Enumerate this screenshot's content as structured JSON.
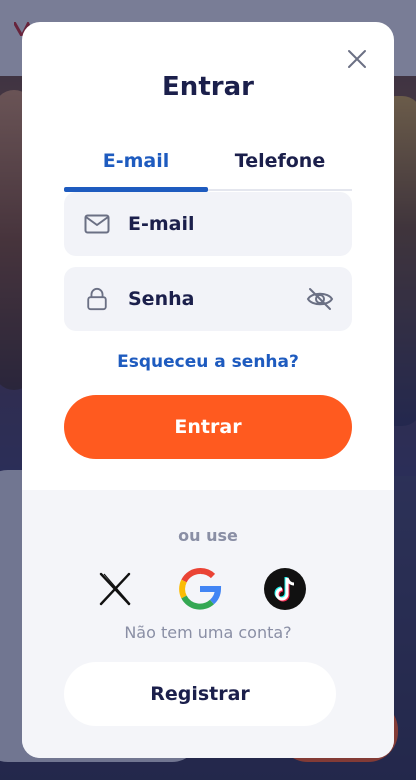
{
  "modal": {
    "title": "Entrar",
    "tabs": [
      {
        "label": "E-mail",
        "active": true
      },
      {
        "label": "Telefone",
        "active": false
      }
    ],
    "email_field": {
      "placeholder": "E-mail",
      "icon": "envelope-icon"
    },
    "password_field": {
      "placeholder": "Senha",
      "icon": "lock-icon",
      "toggle_icon": "eye-off-icon"
    },
    "forgot_label": "Esqueceu a senha?",
    "submit_label": "Entrar",
    "alt_label": "ou use",
    "social": [
      {
        "name": "X",
        "icon": "x-logo-icon"
      },
      {
        "name": "Google",
        "icon": "google-logo-icon"
      },
      {
        "name": "TikTok",
        "icon": "tiktok-logo-icon"
      }
    ],
    "no_account_label": "Não tem uma conta?",
    "register_label": "Registrar"
  },
  "colors": {
    "accent_blue": "#1e5bbf",
    "primary_orange": "#ff5a1f",
    "text_dark": "#1b1f4b",
    "muted": "#8a8fa5"
  }
}
